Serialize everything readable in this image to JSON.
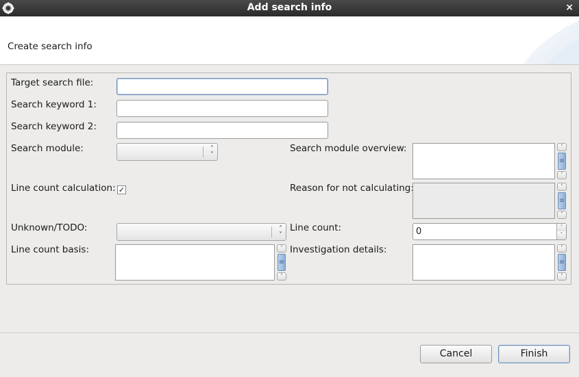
{
  "window": {
    "title": "Add search info",
    "close_glyph": "×"
  },
  "banner": {
    "subtitle": "Create search info"
  },
  "form": {
    "target_file": {
      "label": "Target search file:",
      "value": ""
    },
    "keyword1": {
      "label": "Search keyword 1:",
      "value": ""
    },
    "keyword2": {
      "label": "Search keyword 2:",
      "value": ""
    },
    "module": {
      "label": "Search module:",
      "value": ""
    },
    "module_overview": {
      "label": "Search module overview:",
      "value": ""
    },
    "line_count_calc": {
      "label": "Line count calculation:",
      "checked": true,
      "check_glyph": "✓"
    },
    "reason_not_calc": {
      "label": "Reason for not calculating:",
      "value": ""
    },
    "unknown_todo": {
      "label": "Unknown/TODO:",
      "value": ""
    },
    "line_count": {
      "label": "Line count:",
      "value": "0"
    },
    "line_count_basis": {
      "label": "Line count basis:",
      "value": ""
    },
    "investigation": {
      "label": "Investigation details:",
      "value": ""
    }
  },
  "buttons": {
    "cancel": "Cancel",
    "finish": "Finish"
  },
  "icons": {
    "app": "eclipse-gear-icon",
    "close": "close-icon",
    "spin_up": "chevron-up-icon",
    "spin_down": "chevron-down-icon"
  }
}
